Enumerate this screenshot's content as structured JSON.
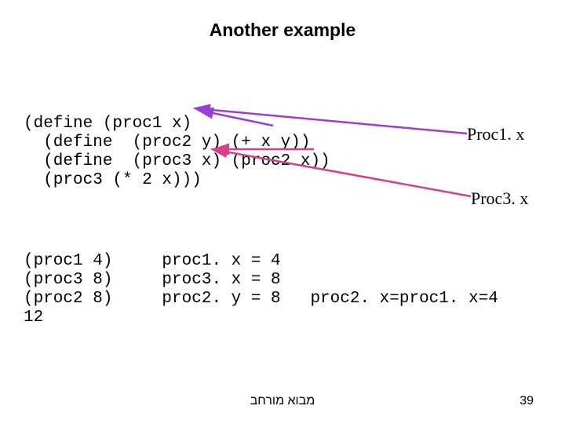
{
  "title": "Another example",
  "code": {
    "line1": "(define (proc1 x)",
    "line2": "  (define  (proc2 y) (+ x y))",
    "line3": "  (define  (proc3 x) (proc2 x))",
    "line4": "  (proc3 (* 2 x)))"
  },
  "annotations": {
    "proc1": "Proc1. x",
    "proc3": "Proc3. x"
  },
  "trace": {
    "row1": "(proc1 4)     proc1. x = 4",
    "row2": "(proc3 8)     proc3. x = 8",
    "row3": "(proc2 8)     proc2. y = 8   proc2. x=proc1. x=4",
    "row4": "12"
  },
  "footer": "מבוא מורחב",
  "page": "39"
}
